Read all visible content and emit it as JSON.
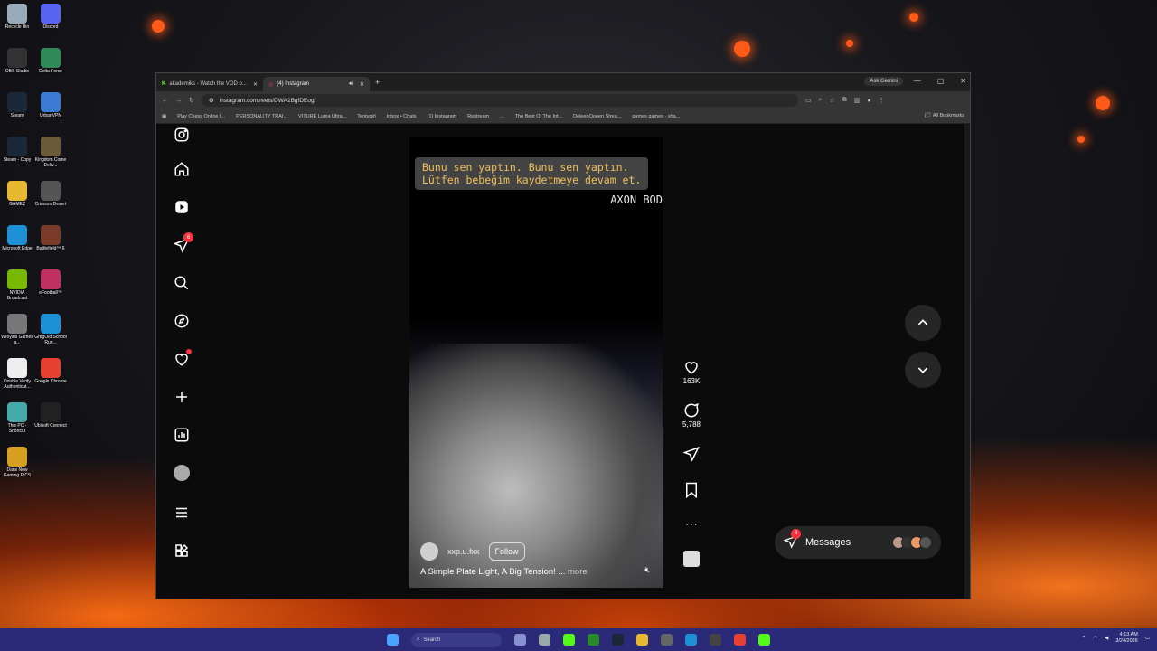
{
  "desktop": {
    "icons": [
      {
        "label": "Recycle Bin",
        "color": "#9ab"
      },
      {
        "label": "Discord",
        "color": "#5865f2"
      },
      {
        "label": "OBS Studio",
        "color": "#333"
      },
      {
        "label": "Delta Force",
        "color": "#2e8b57"
      },
      {
        "label": "Steam",
        "color": "#1b2838"
      },
      {
        "label": "UrbanVPN",
        "color": "#3a7bd5"
      },
      {
        "label": "Steam - Copy",
        "color": "#1b2838"
      },
      {
        "label": "Kingdom Come Deliv...",
        "color": "#6b5a3a"
      },
      {
        "label": "GAMEZ",
        "color": "#e8b830"
      },
      {
        "label": "Crimson Desert",
        "color": "#555"
      },
      {
        "label": "Microsoft Edge",
        "color": "#1e90d6"
      },
      {
        "label": "Battlefield™ 6",
        "color": "#7a3a2a"
      },
      {
        "label": "NVIDIA Broadcast",
        "color": "#76b900"
      },
      {
        "label": "eFootball™",
        "color": "#c03060"
      },
      {
        "label": "Wroyals Games a...",
        "color": "#777"
      },
      {
        "label": "GregOld School Run...",
        "color": "#1e90d6"
      },
      {
        "label": "Double Verify Authenticat...",
        "color": "#eee"
      },
      {
        "label": "Google Chrome",
        "color": "#e84033"
      },
      {
        "label": "This PC - Shortcut",
        "color": "#4aa"
      },
      {
        "label": "Ubisoft Connect",
        "color": "#222"
      },
      {
        "label": "Dans New Gaming PICS",
        "color": "#d8a020"
      }
    ]
  },
  "browser": {
    "tabs": [
      {
        "label": "akademiks - Watch the VOD o..."
      },
      {
        "label": "(4) Instagram"
      }
    ],
    "new_tab": "+",
    "ask_gemini": "Ask Gemini",
    "url": "instagram.com/reels/DWA2BgfDEog/",
    "bookmarks": [
      "Play Chess Online f...",
      "PERSONALITY TRAI...",
      "VITURE Luma Ultra...",
      "Tentygirl",
      "Inbox • Chats",
      "(1) Instagram",
      "Restream",
      "...",
      "The Best Of The Int...",
      "DeleenQueen Strea...",
      "games games - sha..."
    ],
    "all_bookmarks": "All Bookmarks"
  },
  "instagram": {
    "notifications_badge": "6",
    "reel": {
      "subtitle_line1": "Bunu sen yaptın. Bunu sen yaptın.",
      "subtitle_line2": "Lütfen bebeğim kaydetmeye devam et.",
      "overlay_text": "AXON BOD",
      "username": "xxp.u.fxx",
      "follow_label": "Follow",
      "caption": "A Simple Plate Light, A Big Tension! ...",
      "more_label": "more"
    },
    "actions": {
      "likes": "163K",
      "comments": "5,788"
    },
    "messages": {
      "label": "Messages",
      "badge": "4"
    }
  },
  "taskbar": {
    "search_placeholder": "Search",
    "time": "4:13 AM",
    "date": "3/24/2026"
  }
}
